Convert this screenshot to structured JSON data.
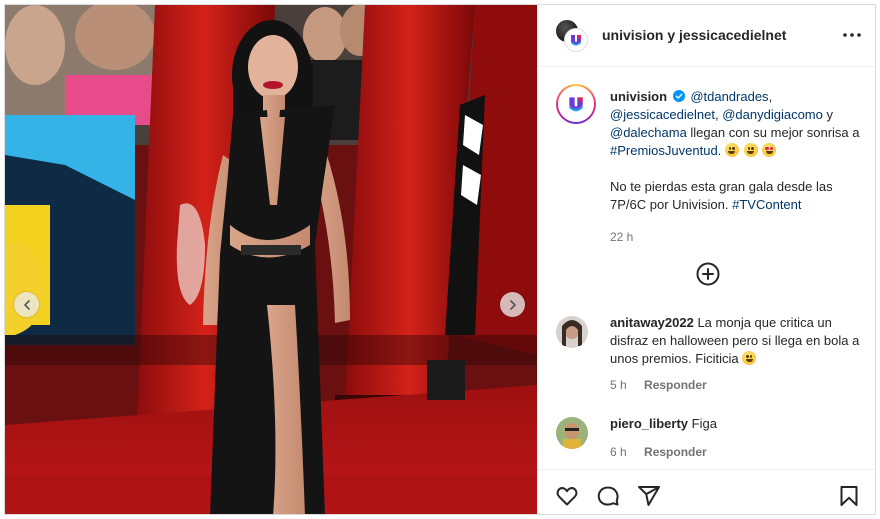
{
  "header": {
    "account_names": "univision y jessicacedielnet",
    "more_icon": "more-horizontal-icon"
  },
  "caption": {
    "username": "univision",
    "verified_icon": "verified-badge-icon",
    "mentions": [
      "@tdandrades",
      "@jessicacedielnet",
      "@danydigiacomo",
      "@dalechama"
    ],
    "connector_1": ", ",
    "connector_2": ", ",
    "connector_3": " y ",
    "text_1": " llegan con su mejor sonrisa a ",
    "hashtag_1": "#PremiosJuventud",
    "text_1_end": ". ",
    "emojis_1": [
      "grinning-face-icon",
      "smiling-face-icon",
      "star-struck-face-icon"
    ],
    "text_2": "No te pierdas esta gran gala desde las 7P/6C por Univision. ",
    "hashtag_2": "#TVContent",
    "time": "22 h"
  },
  "load_more_icon": "add-circle-icon",
  "comments": [
    {
      "username": "anitaway2022",
      "text": " La monja que critica un disfraz en halloween pero si llega en bola a unos premios. Ficiticia ",
      "emoji": "grinning-face-icon",
      "time": "5 h",
      "reply_label": "Responder"
    },
    {
      "username": "piero_liberty",
      "text": " Figa",
      "time": "6 h",
      "reply_label": "Responder"
    }
  ],
  "actions": {
    "like": "heart-icon",
    "comment": "comment-icon",
    "share": "share-icon",
    "save": "bookmark-icon"
  },
  "carousel": {
    "prev": "chevron-left-icon",
    "next": "chevron-right-icon"
  },
  "colors": {
    "link": "#00376b",
    "text": "#262626",
    "muted": "#737373",
    "verified": "#0095f6",
    "carpet_red": "#b31212"
  }
}
